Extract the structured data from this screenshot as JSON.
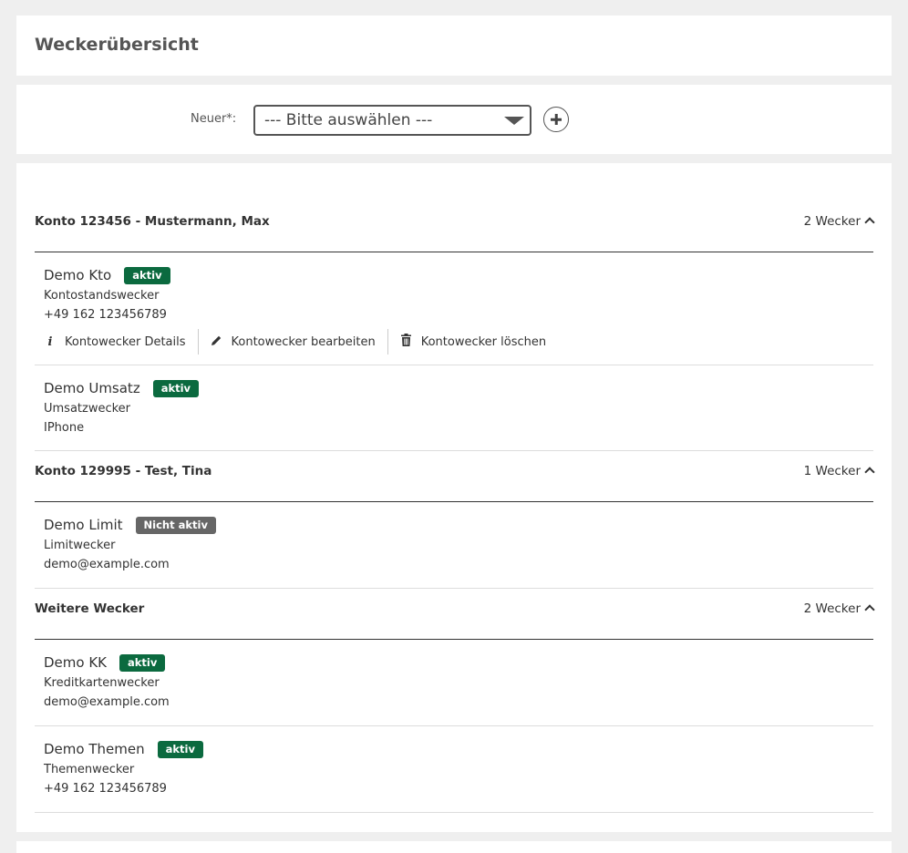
{
  "page": {
    "title": "Weckerübersicht"
  },
  "new_alarm": {
    "label": "Neuer*:",
    "select_value": "--- Bitte auswählen ---"
  },
  "groups": [
    {
      "title": "Konto 123456 - Mustermann, Max",
      "count": "2 Wecker",
      "items": [
        {
          "name": "Demo Kto",
          "status": "aktiv",
          "type": "Kontostandswecker",
          "contact": "+49 162 123456789",
          "actions": [
            {
              "label": "Kontowecker Details",
              "icon": "info-icon"
            },
            {
              "label": "Kontowecker bearbeiten",
              "icon": "pencil-icon"
            },
            {
              "label": "Kontowecker löschen",
              "icon": "trash-icon"
            }
          ]
        },
        {
          "name": "Demo Umsatz",
          "status": "aktiv",
          "type": "Umsatzwecker",
          "contact": "IPhone"
        }
      ]
    },
    {
      "title": "Konto 129995 - Test, Tina",
      "count": "1 Wecker",
      "items": [
        {
          "name": "Demo Limit",
          "status": "Nicht aktiv",
          "type": "Limitwecker",
          "contact": "demo@example.com"
        }
      ]
    },
    {
      "title": "Weitere Wecker",
      "count": "2 Wecker",
      "items": [
        {
          "name": "Demo KK",
          "status": "aktiv",
          "type": "Kreditkartenwecker",
          "contact": "demo@example.com"
        },
        {
          "name": "Demo Themen",
          "status": "aktiv",
          "type": "Themenwecker",
          "contact": "+49 162 123456789"
        }
      ]
    }
  ],
  "colors": {
    "badge_active": "#0b6a3f",
    "badge_inactive": "#666666",
    "background": "#efefef"
  }
}
